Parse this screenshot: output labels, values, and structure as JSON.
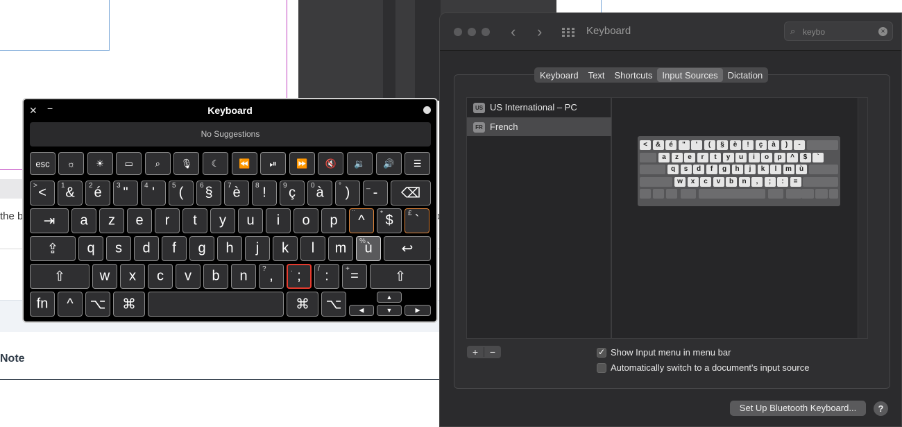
{
  "background": {
    "partial_text": "the b",
    "note_heading": "Note",
    "right_fragment": "o"
  },
  "keyboard_viewer": {
    "title": "Keyboard",
    "suggestions": "No Suggestions",
    "row_fn": {
      "esc": "esc",
      "icons": [
        "brightness-down-icon",
        "brightness-up-icon",
        "mission-control-icon",
        "spotlight-icon",
        "dictation-icon",
        "do-not-disturb-icon",
        "rewind-icon",
        "play-pause-icon",
        "fast-forward-icon",
        "mute-icon",
        "volume-down-icon",
        "volume-up-icon",
        "list-icon"
      ]
    },
    "row1": [
      {
        "main": "<",
        "sup": ">"
      },
      {
        "main": "&",
        "sup": "1"
      },
      {
        "main": "é",
        "sup": "2"
      },
      {
        "main": "\"",
        "sup": "3"
      },
      {
        "main": "'",
        "sup": "4"
      },
      {
        "main": "(",
        "sup": "5"
      },
      {
        "main": "§",
        "sup": "6"
      },
      {
        "main": "è",
        "sup": "7"
      },
      {
        "main": "!",
        "sup": "8"
      },
      {
        "main": "ç",
        "sup": "9"
      },
      {
        "main": "à",
        "sup": "0"
      },
      {
        "main": ")",
        "sup": "°"
      },
      {
        "main": "-",
        "sup": "_"
      }
    ],
    "row2": [
      {
        "main": "a",
        "sup": ""
      },
      {
        "main": "z",
        "sup": ""
      },
      {
        "main": "e",
        "sup": ""
      },
      {
        "main": "r",
        "sup": ""
      },
      {
        "main": "t",
        "sup": ""
      },
      {
        "main": "y",
        "sup": ""
      },
      {
        "main": "u",
        "sup": ""
      },
      {
        "main": "i",
        "sup": ""
      },
      {
        "main": "o",
        "sup": ""
      },
      {
        "main": "p",
        "sup": ""
      },
      {
        "main": "^",
        "sup": "¨"
      },
      {
        "main": "$",
        "sup": "*"
      },
      {
        "main": "`",
        "sup": "£"
      }
    ],
    "row3": [
      {
        "main": "q",
        "sup": ""
      },
      {
        "main": "s",
        "sup": ""
      },
      {
        "main": "d",
        "sup": ""
      },
      {
        "main": "f",
        "sup": ""
      },
      {
        "main": "g",
        "sup": ""
      },
      {
        "main": "h",
        "sup": ""
      },
      {
        "main": "j",
        "sup": ""
      },
      {
        "main": "k",
        "sup": ""
      },
      {
        "main": "l",
        "sup": ""
      },
      {
        "main": "m",
        "sup": ""
      },
      {
        "main": "ù",
        "sup": "%"
      }
    ],
    "row4": [
      {
        "main": "w",
        "sup": ""
      },
      {
        "main": "x",
        "sup": ""
      },
      {
        "main": "c",
        "sup": ""
      },
      {
        "main": "v",
        "sup": ""
      },
      {
        "main": "b",
        "sup": ""
      },
      {
        "main": "n",
        "sup": ""
      },
      {
        "main": ",",
        "sup": "?"
      },
      {
        "main": ";",
        "sup": "."
      },
      {
        "main": ":",
        "sup": "/"
      },
      {
        "main": "=",
        "sup": "+"
      }
    ],
    "row5": {
      "fn": "fn",
      "control": "^",
      "option": "⌥",
      "command": "⌘"
    },
    "arrows": {
      "up": "▲",
      "left": "◀",
      "down": "▼",
      "right": "▶"
    },
    "special": {
      "delete": "⌫",
      "tab": "⇥",
      "caps": "⇪",
      "return": "↩",
      "shift": "⇧"
    }
  },
  "sys_prefs": {
    "title": "Keyboard",
    "search_value": "keybo",
    "tabs": [
      {
        "label": "Keyboard",
        "active": false
      },
      {
        "label": "Text",
        "active": false
      },
      {
        "label": "Shortcuts",
        "active": false
      },
      {
        "label": "Input Sources",
        "active": true
      },
      {
        "label": "Dictation",
        "active": false
      }
    ],
    "input_sources": [
      {
        "badge": "US",
        "name": "US International – PC",
        "selected": false
      },
      {
        "badge": "FR",
        "name": "French",
        "selected": true
      }
    ],
    "mini_keyboard_rows": [
      [
        "<",
        "&",
        "é",
        "\"",
        "'",
        "(",
        "§",
        "è",
        "!",
        "ç",
        "à",
        ")",
        "-"
      ],
      [
        "a",
        "z",
        "e",
        "r",
        "t",
        "y",
        "u",
        "i",
        "o",
        "p",
        "^",
        "$",
        "`"
      ],
      [
        "q",
        "s",
        "d",
        "f",
        "g",
        "h",
        "j",
        "k",
        "l",
        "m",
        "ù"
      ],
      [
        "w",
        "x",
        "c",
        "v",
        "b",
        "n",
        ",",
        ";",
        ":",
        "="
      ]
    ],
    "plus": "+",
    "minus": "−",
    "show_input_menu": {
      "label": "Show Input menu in menu bar",
      "checked": true
    },
    "auto_switch": {
      "label": "Automatically switch to a document's input source",
      "checked": false
    },
    "bluetooth_button": "Set Up Bluetooth Keyboard...",
    "help": "?"
  }
}
